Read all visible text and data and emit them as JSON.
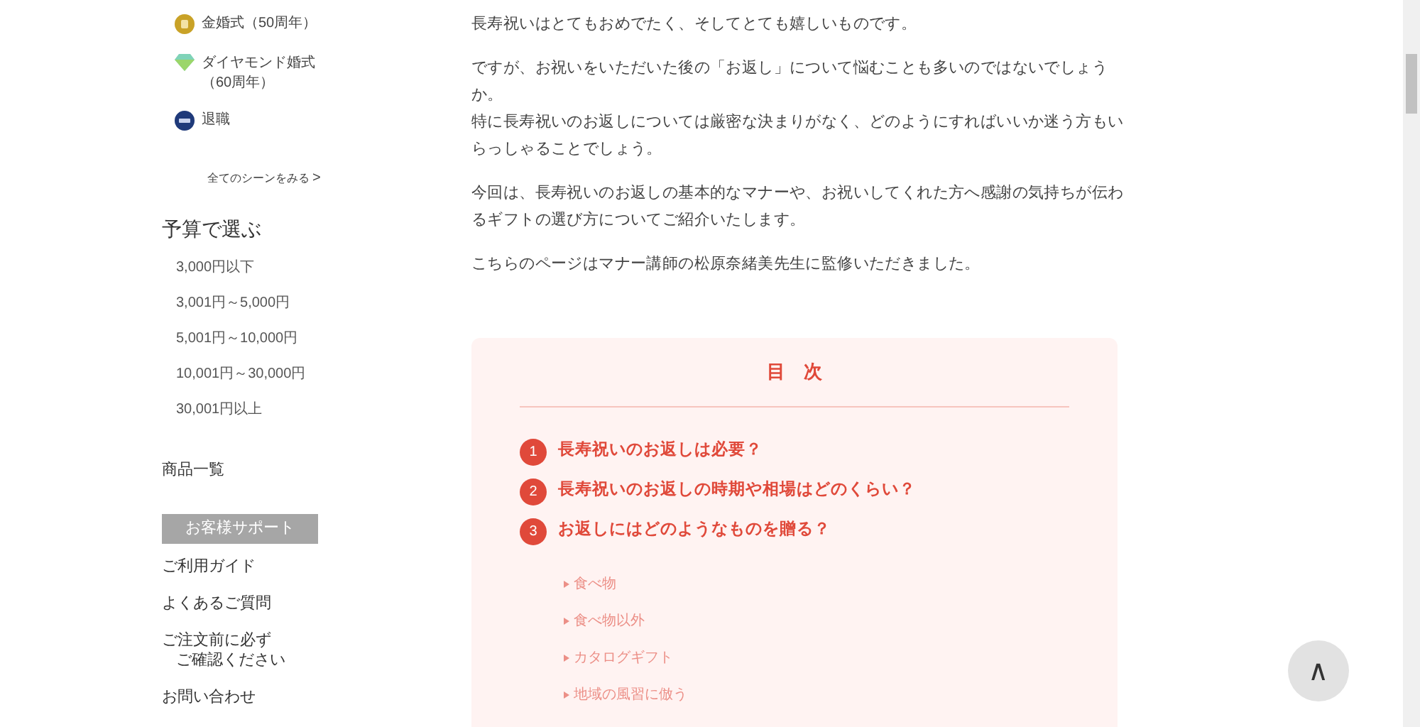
{
  "sidebar": {
    "scenes": [
      {
        "kind": "gold",
        "label": "金婚式（50周年）"
      },
      {
        "kind": "diamond",
        "label": "ダイヤモンド婚式（60周年）"
      },
      {
        "kind": "navy",
        "label": "退職"
      }
    ],
    "all_scenes_link": "全てのシーンをみる",
    "all_scenes_arrow": ">",
    "budget_heading": "予算で選ぶ",
    "budget_items": [
      "3,000円以下",
      "3,001円～5,000円",
      "5,001円～10,000円",
      "10,001円～30,000円",
      "30,001円以上"
    ],
    "products_link": "商品一覧",
    "support_heading": "お客様サポート",
    "support_links": [
      [
        "ご利用ガイド"
      ],
      [
        "よくあるご質問"
      ],
      [
        "ご注文前に必ず",
        "ご確認ください"
      ],
      [
        "お問い合わせ"
      ]
    ]
  },
  "article": {
    "paragraphs": [
      [
        "長寿祝いはとてもおめでたく、そしてとても嬉しいものです。"
      ],
      [
        "ですが、お祝いをいただいた後の「お返し」について悩むことも多いのではないでしょう",
        "か。",
        "特に長寿祝いのお返しについては厳密な決まりがなく、どのようにすればいいか迷う方もい",
        "らっしゃることでしょう。"
      ],
      [
        "今回は、長寿祝いのお返しの基本的なマナーや、お祝いしてくれた方へ感謝の気持ちが伝わ",
        "るギフトの選び方についてご紹介いたします。"
      ],
      [
        "こちらのページはマナー講師の松原奈緒美先生に監修いただきました。"
      ]
    ]
  },
  "toc": {
    "title": "目　次",
    "items": [
      {
        "number": "1",
        "label": "長寿祝いのお返しは必要？"
      },
      {
        "number": "2",
        "label": "長寿祝いのお返しの時期や相場はどのくらい？"
      },
      {
        "number": "3",
        "label": "お返しにはどのようなものを贈る？",
        "children": [
          {
            "label": "食べ物"
          },
          {
            "label": "食べ物以外"
          },
          {
            "label": "カタログギフト"
          },
          {
            "label": "地域の風習に倣う"
          }
        ]
      }
    ]
  },
  "back_to_top": {
    "label": "∧"
  }
}
